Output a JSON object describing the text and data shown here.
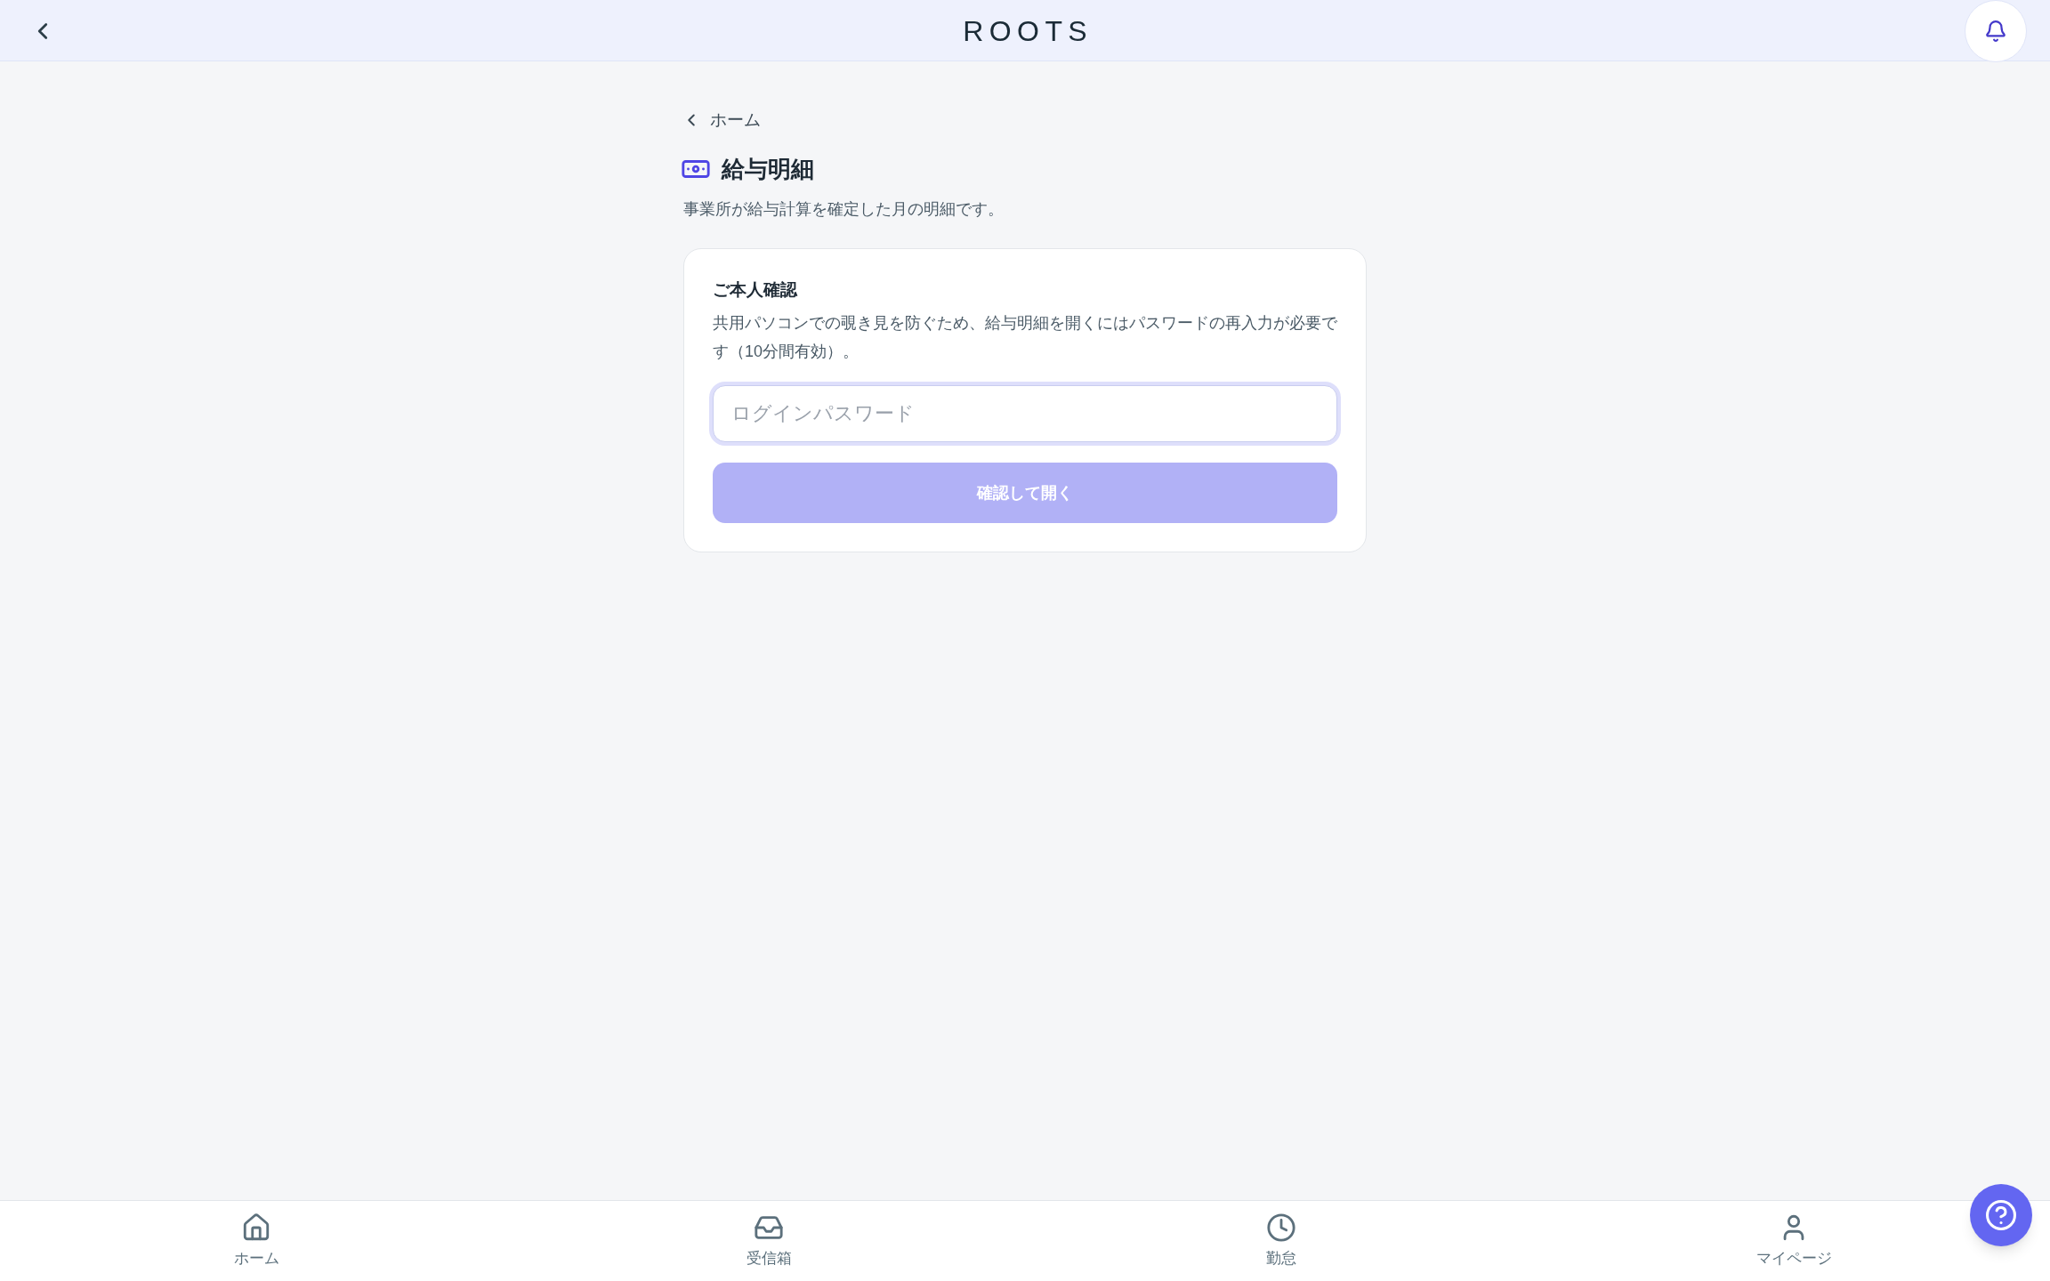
{
  "header": {
    "title": "ROOTS"
  },
  "breadcrumb": {
    "label": "ホーム"
  },
  "page": {
    "title": "給与明細",
    "description": "事業所が給与計算を確定した月の明細です。"
  },
  "verification_card": {
    "title": "ご本人確認",
    "description": "共用パソコンでの覗き見を防ぐため、給与明細を開くにはパスワードの再入力が必要です（10分間有効）。",
    "password_field": {
      "placeholder": "ログインパスワード",
      "focused": true
    },
    "submit_button": {
      "label": "確認して開く",
      "disabled": true
    }
  },
  "bottom_nav": {
    "items": [
      {
        "label": "ホーム"
      },
      {
        "label": "受信箱"
      },
      {
        "label": "勤怠"
      },
      {
        "label": "マイページ"
      }
    ]
  }
}
